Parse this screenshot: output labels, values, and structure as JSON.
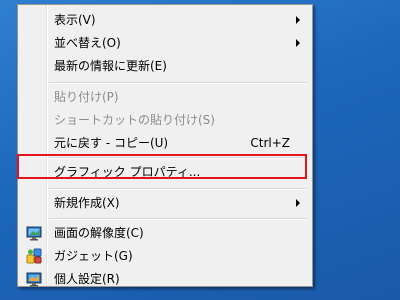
{
  "menu": {
    "items": [
      {
        "label": "表示(V)",
        "shortcut": "",
        "submenu": true,
        "disabled": false,
        "icon": ""
      },
      {
        "label": "並べ替え(O)",
        "shortcut": "",
        "submenu": true,
        "disabled": false,
        "icon": ""
      },
      {
        "label": "最新の情報に更新(E)",
        "shortcut": "",
        "submenu": false,
        "disabled": false,
        "icon": ""
      },
      {
        "label": "貼り付け(P)",
        "shortcut": "",
        "submenu": false,
        "disabled": true,
        "icon": ""
      },
      {
        "label": "ショートカットの貼り付け(S)",
        "shortcut": "",
        "submenu": false,
        "disabled": true,
        "icon": ""
      },
      {
        "label": "元に戻す - コピー(U)",
        "shortcut": "Ctrl+Z",
        "submenu": false,
        "disabled": false,
        "icon": ""
      },
      {
        "label": "グラフィック プロパティ...",
        "shortcut": "",
        "submenu": false,
        "disabled": false,
        "icon": "",
        "highlighted": true
      },
      {
        "label": "新規作成(X)",
        "shortcut": "",
        "submenu": true,
        "disabled": false,
        "icon": ""
      },
      {
        "label": "画面の解像度(C)",
        "shortcut": "",
        "submenu": false,
        "disabled": false,
        "icon": "monitor-icon"
      },
      {
        "label": "ガジェット(G)",
        "shortcut": "",
        "submenu": false,
        "disabled": false,
        "icon": "gadget-icon"
      },
      {
        "label": "個人設定(R)",
        "shortcut": "",
        "submenu": false,
        "disabled": false,
        "icon": "personalize-icon"
      }
    ]
  },
  "colors": {
    "highlight_border": "#e1151b",
    "desktop_background": "#1d66bb",
    "disabled_text": "#8d8d8d"
  }
}
